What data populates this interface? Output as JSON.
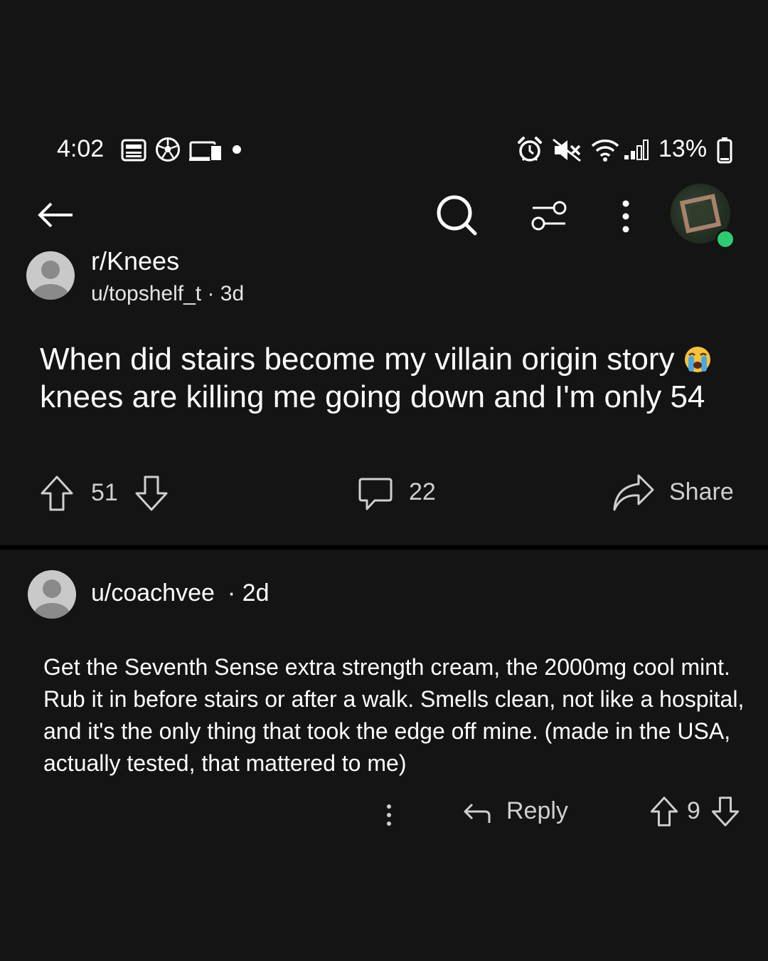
{
  "status_bar": {
    "time": "4:02",
    "battery": "13%",
    "left_icons": [
      "news-icon",
      "soccer-icon",
      "devices-icon",
      "dot-icon"
    ],
    "right_icons": [
      "alarm-icon",
      "mute-icon",
      "wifi-icon",
      "signal-icon",
      "battery-icon"
    ]
  },
  "topbar": {
    "icons": [
      "back-arrow-icon",
      "search-icon",
      "filter-icon",
      "more-vertical-icon"
    ]
  },
  "post": {
    "subreddit": "r/Knees",
    "meta": "u/topshelf_t · 3d",
    "title_part1": "When did stairs become my villain origin story ",
    "title_part2": " knees are killing me going down and I'm only 54",
    "upvotes": "51",
    "comments": "22",
    "share_label": "Share"
  },
  "comment": {
    "user": "u/coachvee",
    "age": "· 2d",
    "body": "Get the Seventh Sense extra strength cream, the 2000mg cool mint. Rub it in before stairs or after a walk. Smells clean, not like a hospital, and it's the only thing that took the edge off mine. (made in the USA, actually tested, that mattered to me)",
    "reply_label": "Reply",
    "votes": "9"
  },
  "colors": {
    "background": "#141414",
    "text": "#ffffff",
    "muted": "#cfcfcf",
    "online": "#2ecc71"
  }
}
